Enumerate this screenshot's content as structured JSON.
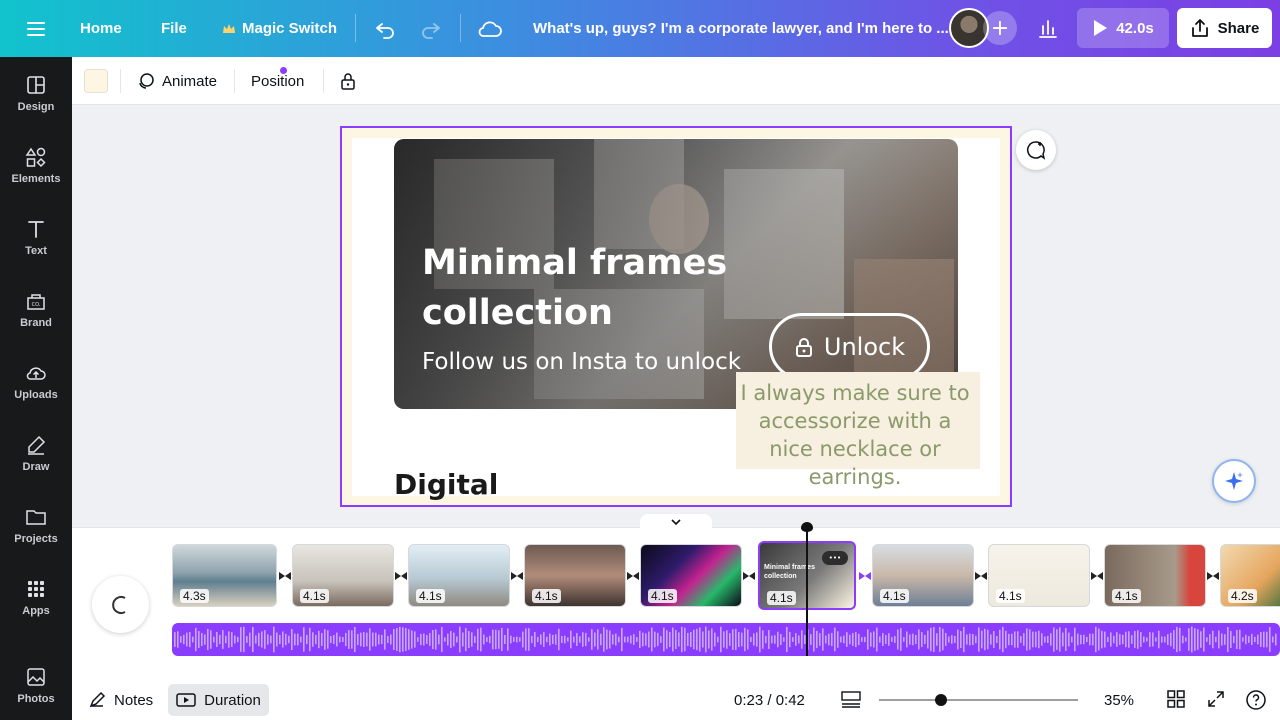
{
  "topbar": {
    "menu_icon": "hamburger-icon",
    "home": "Home",
    "file": "File",
    "magic_switch": "Magic Switch",
    "title": "What's up, guys? I'm a corporate lawyer, and I'm here to ...",
    "preview_time": "42.0s",
    "share": "Share"
  },
  "sidebar": {
    "items": [
      {
        "label": "Design",
        "icon": "design-icon"
      },
      {
        "label": "Elements",
        "icon": "elements-icon"
      },
      {
        "label": "Text",
        "icon": "text-icon"
      },
      {
        "label": "Brand",
        "icon": "brand-icon"
      },
      {
        "label": "Uploads",
        "icon": "upload-icon"
      },
      {
        "label": "Draw",
        "icon": "draw-icon"
      },
      {
        "label": "Projects",
        "icon": "folder-icon"
      },
      {
        "label": "Apps",
        "icon": "apps-icon"
      },
      {
        "label": "Photos",
        "icon": "photos-icon"
      }
    ]
  },
  "toolbar": {
    "swatch_color": "#fdf6e3",
    "animate": "Animate",
    "position": "Position"
  },
  "canvas": {
    "headline": "Minimal frames collection",
    "subline": "Follow us on Insta to unlock",
    "unlock": "Unlock",
    "caption": "I always make sure to accessorize with a nice necklace or earrings.",
    "digital": "Digital"
  },
  "timeline": {
    "clips": [
      "4.3s",
      "4.1s",
      "4.1s",
      "4.1s",
      "4.1s",
      "4.1s",
      "4.1s",
      "4.1s",
      "4.1s",
      "4.2s"
    ],
    "selected_clip_index": 5,
    "selected_clip_title": "Minimal frames collection",
    "playhead_fraction": 0.548
  },
  "footer": {
    "notes": "Notes",
    "duration": "Duration",
    "time": "0:23 / 0:42",
    "zoom": "35%"
  },
  "colors": {
    "accent": "#8b3dff",
    "sidebar_bg": "#18191b",
    "caption_text": "#8a9a6a"
  }
}
